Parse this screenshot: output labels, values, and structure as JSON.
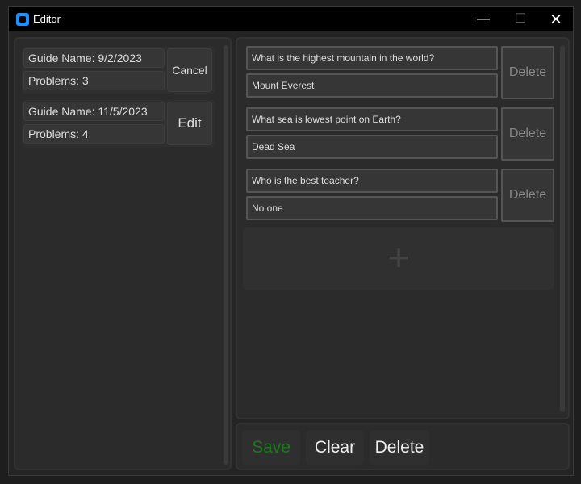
{
  "window": {
    "title": "Editor",
    "minimize": "—",
    "maximize": "☐",
    "close": "✕"
  },
  "guides": [
    {
      "name_label": "Guide Name: 9/2/2023",
      "problems_label": "Problems: 3",
      "action": "Cancel"
    },
    {
      "name_label": "Guide Name: 11/5/2023",
      "problems_label": "Problems: 4",
      "action": "Edit"
    }
  ],
  "problems": [
    {
      "question": "What is the highest mountain in the world?",
      "answer": "Mount Everest",
      "delete_label": "Delete"
    },
    {
      "question": "What sea is lowest point on Earth?",
      "answer": "Dead Sea",
      "delete_label": "Delete"
    },
    {
      "question": "Who is the best teacher?",
      "answer": "No one",
      "delete_label": "Delete"
    }
  ],
  "add_problem_symbol": "+",
  "toolbar": {
    "save_label": "Save",
    "clear_label": "Clear",
    "delete_label": "Delete"
  },
  "colors": {
    "save_text": "#1a7a1a",
    "app_icon": "#1e90ff"
  }
}
